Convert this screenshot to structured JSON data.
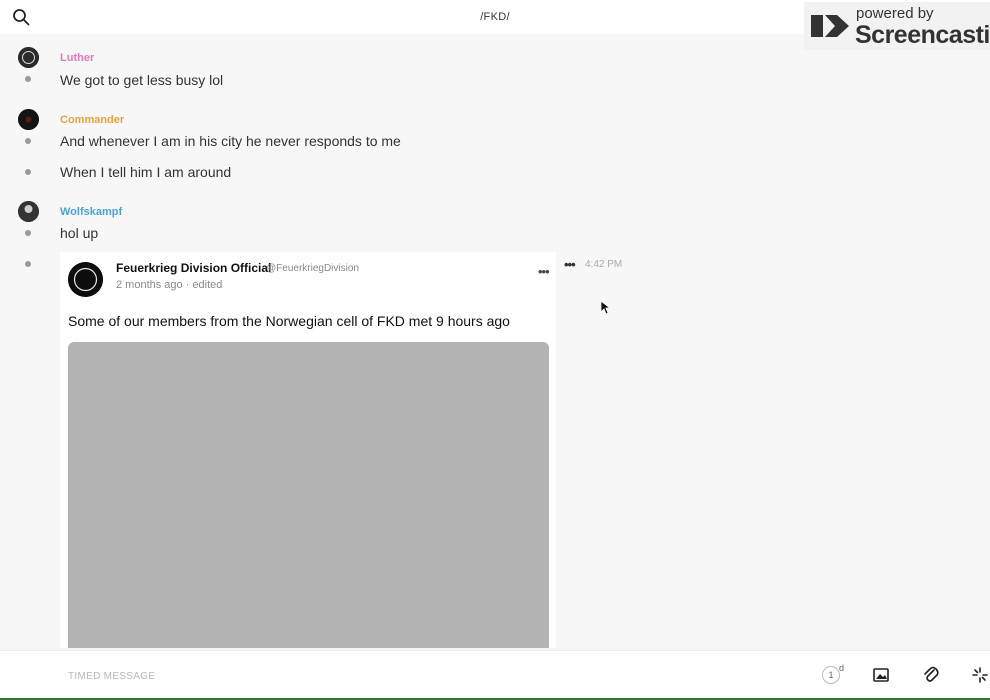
{
  "header": {
    "search_icon": "search-icon",
    "channel_name": "/FKD/"
  },
  "watermark": {
    "line1": "powered by",
    "line2": "Screencastify"
  },
  "messages": [
    {
      "username": "Luther",
      "color": "#e37bb8",
      "lines": [
        "We got to get less busy lol"
      ]
    },
    {
      "username": "Commander",
      "color": "#e6a33c",
      "lines": [
        "And whenever I am in his city he never responds to me",
        "When I tell him I am around"
      ]
    },
    {
      "username": "Wolfskampf",
      "color": "#4aa3d8",
      "lines": [
        "hol up"
      ]
    }
  ],
  "embed": {
    "name": "Feuerkrieg Division Official",
    "handle": "@FeuerkriegDivision",
    "meta": "2 months ago · edited",
    "text": "Some of our members from the Norwegian cell of FKD met 9 hours ago",
    "menu_icon": "ellipsis-icon"
  },
  "message_meta": {
    "more_icon": "ellipsis-icon",
    "time": "4:42 PM"
  },
  "composer": {
    "placeholder": "TIMED MESSAGE",
    "timer_value": "1",
    "timer_unit": "d",
    "image_icon": "image-icon",
    "attach_icon": "paperclip-icon",
    "sparkle_icon": "sparkle-icon"
  }
}
